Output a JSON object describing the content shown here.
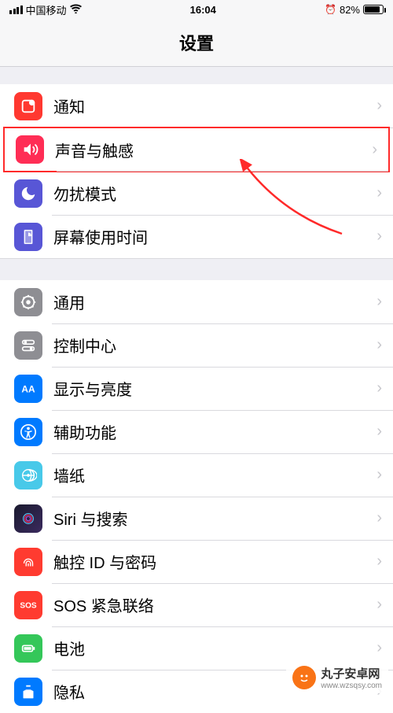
{
  "status": {
    "carrier": "中国移动",
    "time": "16:04",
    "battery_percent": "82%"
  },
  "header": {
    "title": "设置"
  },
  "groups": [
    {
      "items": [
        {
          "key": "notifications",
          "label": "通知"
        },
        {
          "key": "sound",
          "label": "声音与触感",
          "highlighted": true
        },
        {
          "key": "dnd",
          "label": "勿扰模式"
        },
        {
          "key": "screentime",
          "label": "屏幕使用时间"
        }
      ]
    },
    {
      "items": [
        {
          "key": "general",
          "label": "通用"
        },
        {
          "key": "control",
          "label": "控制中心"
        },
        {
          "key": "display",
          "label": "显示与亮度"
        },
        {
          "key": "accessibility",
          "label": "辅助功能"
        },
        {
          "key": "wallpaper",
          "label": "墙纸"
        },
        {
          "key": "siri",
          "label": "Siri 与搜索"
        },
        {
          "key": "touchid",
          "label": "触控 ID 与密码"
        },
        {
          "key": "sos",
          "label": "SOS 紧急联络"
        },
        {
          "key": "battery",
          "label": "电池"
        },
        {
          "key": "privacy",
          "label": "隐私"
        }
      ]
    }
  ],
  "annotation": {
    "arrow_color": "#ff2a2a"
  },
  "watermark": {
    "brand": "丸子安卓网",
    "url": "www.wzsqsy.com"
  },
  "icons": {
    "sos_text": "SOS",
    "display_text": "AA"
  }
}
